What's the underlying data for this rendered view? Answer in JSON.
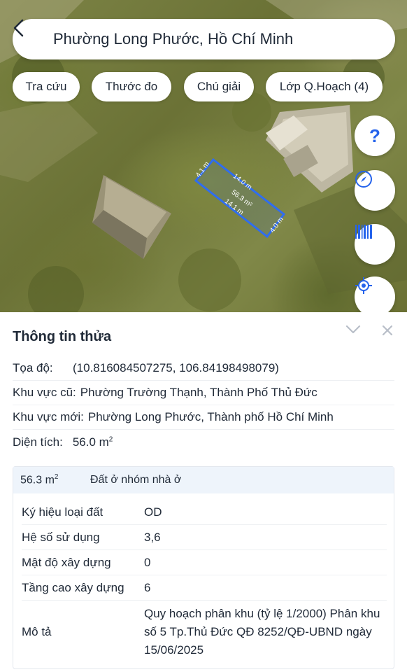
{
  "search": {
    "title": "Phường Long Phước, Hồ Chí Minh"
  },
  "chips": [
    "Tra cứu",
    "Thước đo",
    "Chú giải",
    "Lớp Q.Hoạch (4)"
  ],
  "map": {
    "parcel_area": "56.3 m²",
    "edge_top": "14.0 m",
    "edge_bottom": "14.1 m",
    "edge_left": "4.1 m",
    "edge_right": "4.0 m",
    "parcel_color": "#2f6df0"
  },
  "fabs": {
    "help": "?",
    "compass_icon": "compass-icon",
    "barcode_icon": "barcode-icon",
    "locate_icon": "locate-icon"
  },
  "panel": {
    "title": "Thông tin thửa",
    "coord_label": "Tọa độ:",
    "coord_value": "(10.816084507275, 106.84198498079)",
    "old_area_label": "Khu vực cũ:",
    "old_area_value": "Phường Trường Thạnh, Thành Phố Thủ Đức",
    "new_area_label": "Khu vực mới:",
    "new_area_value": "Phường Long Phước, Thành phố Hồ Chí Minh",
    "size_label": "Diện tích:",
    "size_value": "56.0 m",
    "size_sup": "2"
  },
  "zone": {
    "area": "56.3 m",
    "area_sup": "2",
    "type": "Đất ở nhóm nhà ở",
    "rows": [
      {
        "key": "Ký hiệu loại đất",
        "value": "OD"
      },
      {
        "key": "Hệ số sử dụng",
        "value": "3,6"
      },
      {
        "key": "Mật độ xây dựng",
        "value": "0"
      },
      {
        "key": "Tầng cao xây dựng",
        "value": "6"
      },
      {
        "key": "Mô tả",
        "value": "Quy hoạch phân khu (tỷ lệ 1/2000) Phân khu số 5 Tp.Thủ Đức QĐ 8252/QĐ-UBND ngày 15/06/2025"
      }
    ]
  },
  "colors": {
    "accent": "#2563eb",
    "header_bg": "#eef4fb"
  }
}
